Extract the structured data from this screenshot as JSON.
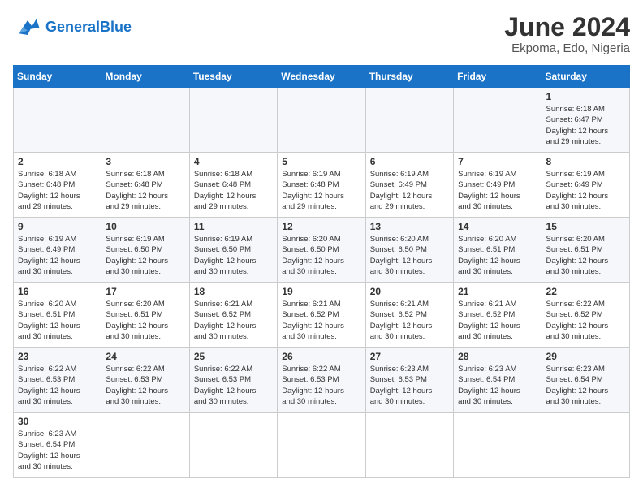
{
  "logo": {
    "text_general": "General",
    "text_blue": "Blue"
  },
  "header": {
    "title": "June 2024",
    "subtitle": "Ekpoma, Edo, Nigeria"
  },
  "weekdays": [
    "Sunday",
    "Monday",
    "Tuesday",
    "Wednesday",
    "Thursday",
    "Friday",
    "Saturday"
  ],
  "weeks": [
    [
      {
        "day": "",
        "info": ""
      },
      {
        "day": "",
        "info": ""
      },
      {
        "day": "",
        "info": ""
      },
      {
        "day": "",
        "info": ""
      },
      {
        "day": "",
        "info": ""
      },
      {
        "day": "",
        "info": ""
      },
      {
        "day": "1",
        "info": "Sunrise: 6:18 AM\nSunset: 6:47 PM\nDaylight: 12 hours\nand 29 minutes."
      }
    ],
    [
      {
        "day": "2",
        "info": "Sunrise: 6:18 AM\nSunset: 6:48 PM\nDaylight: 12 hours\nand 29 minutes."
      },
      {
        "day": "3",
        "info": "Sunrise: 6:18 AM\nSunset: 6:48 PM\nDaylight: 12 hours\nand 29 minutes."
      },
      {
        "day": "4",
        "info": "Sunrise: 6:18 AM\nSunset: 6:48 PM\nDaylight: 12 hours\nand 29 minutes."
      },
      {
        "day": "5",
        "info": "Sunrise: 6:19 AM\nSunset: 6:48 PM\nDaylight: 12 hours\nand 29 minutes."
      },
      {
        "day": "6",
        "info": "Sunrise: 6:19 AM\nSunset: 6:49 PM\nDaylight: 12 hours\nand 29 minutes."
      },
      {
        "day": "7",
        "info": "Sunrise: 6:19 AM\nSunset: 6:49 PM\nDaylight: 12 hours\nand 30 minutes."
      },
      {
        "day": "8",
        "info": "Sunrise: 6:19 AM\nSunset: 6:49 PM\nDaylight: 12 hours\nand 30 minutes."
      }
    ],
    [
      {
        "day": "9",
        "info": "Sunrise: 6:19 AM\nSunset: 6:49 PM\nDaylight: 12 hours\nand 30 minutes."
      },
      {
        "day": "10",
        "info": "Sunrise: 6:19 AM\nSunset: 6:50 PM\nDaylight: 12 hours\nand 30 minutes."
      },
      {
        "day": "11",
        "info": "Sunrise: 6:19 AM\nSunset: 6:50 PM\nDaylight: 12 hours\nand 30 minutes."
      },
      {
        "day": "12",
        "info": "Sunrise: 6:20 AM\nSunset: 6:50 PM\nDaylight: 12 hours\nand 30 minutes."
      },
      {
        "day": "13",
        "info": "Sunrise: 6:20 AM\nSunset: 6:50 PM\nDaylight: 12 hours\nand 30 minutes."
      },
      {
        "day": "14",
        "info": "Sunrise: 6:20 AM\nSunset: 6:51 PM\nDaylight: 12 hours\nand 30 minutes."
      },
      {
        "day": "15",
        "info": "Sunrise: 6:20 AM\nSunset: 6:51 PM\nDaylight: 12 hours\nand 30 minutes."
      }
    ],
    [
      {
        "day": "16",
        "info": "Sunrise: 6:20 AM\nSunset: 6:51 PM\nDaylight: 12 hours\nand 30 minutes."
      },
      {
        "day": "17",
        "info": "Sunrise: 6:20 AM\nSunset: 6:51 PM\nDaylight: 12 hours\nand 30 minutes."
      },
      {
        "day": "18",
        "info": "Sunrise: 6:21 AM\nSunset: 6:52 PM\nDaylight: 12 hours\nand 30 minutes."
      },
      {
        "day": "19",
        "info": "Sunrise: 6:21 AM\nSunset: 6:52 PM\nDaylight: 12 hours\nand 30 minutes."
      },
      {
        "day": "20",
        "info": "Sunrise: 6:21 AM\nSunset: 6:52 PM\nDaylight: 12 hours\nand 30 minutes."
      },
      {
        "day": "21",
        "info": "Sunrise: 6:21 AM\nSunset: 6:52 PM\nDaylight: 12 hours\nand 30 minutes."
      },
      {
        "day": "22",
        "info": "Sunrise: 6:22 AM\nSunset: 6:52 PM\nDaylight: 12 hours\nand 30 minutes."
      }
    ],
    [
      {
        "day": "23",
        "info": "Sunrise: 6:22 AM\nSunset: 6:53 PM\nDaylight: 12 hours\nand 30 minutes."
      },
      {
        "day": "24",
        "info": "Sunrise: 6:22 AM\nSunset: 6:53 PM\nDaylight: 12 hours\nand 30 minutes."
      },
      {
        "day": "25",
        "info": "Sunrise: 6:22 AM\nSunset: 6:53 PM\nDaylight: 12 hours\nand 30 minutes."
      },
      {
        "day": "26",
        "info": "Sunrise: 6:22 AM\nSunset: 6:53 PM\nDaylight: 12 hours\nand 30 minutes."
      },
      {
        "day": "27",
        "info": "Sunrise: 6:23 AM\nSunset: 6:53 PM\nDaylight: 12 hours\nand 30 minutes."
      },
      {
        "day": "28",
        "info": "Sunrise: 6:23 AM\nSunset: 6:54 PM\nDaylight: 12 hours\nand 30 minutes."
      },
      {
        "day": "29",
        "info": "Sunrise: 6:23 AM\nSunset: 6:54 PM\nDaylight: 12 hours\nand 30 minutes."
      }
    ],
    [
      {
        "day": "30",
        "info": "Sunrise: 6:23 AM\nSunset: 6:54 PM\nDaylight: 12 hours\nand 30 minutes."
      },
      {
        "day": "",
        "info": ""
      },
      {
        "day": "",
        "info": ""
      },
      {
        "day": "",
        "info": ""
      },
      {
        "day": "",
        "info": ""
      },
      {
        "day": "",
        "info": ""
      },
      {
        "day": "",
        "info": ""
      }
    ]
  ]
}
